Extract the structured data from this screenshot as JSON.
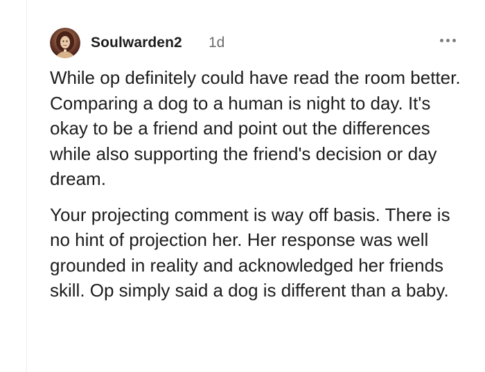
{
  "comment": {
    "username": "Soulwarden2",
    "timestamp": "1d",
    "more_icon": "ellipsis-horizontal-icon",
    "avatar_icon": "user-avatar-icon",
    "paragraphs": [
      "While op definitely could have read the room better. Comparing a dog to a human is night to day. It's okay to be a friend and point out the differences while also supporting the friend's decision or day dream.",
      "Your projecting comment is way off basis. There is no hint of projection her. Her response was well grounded in reality and acknowledged her friends skill. Op simply said a dog is different than a baby."
    ]
  },
  "colors": {
    "background": "#ffffff",
    "text": "#1c1c1c",
    "meta": "#6b6b6b",
    "thread_line": "#ececec"
  }
}
